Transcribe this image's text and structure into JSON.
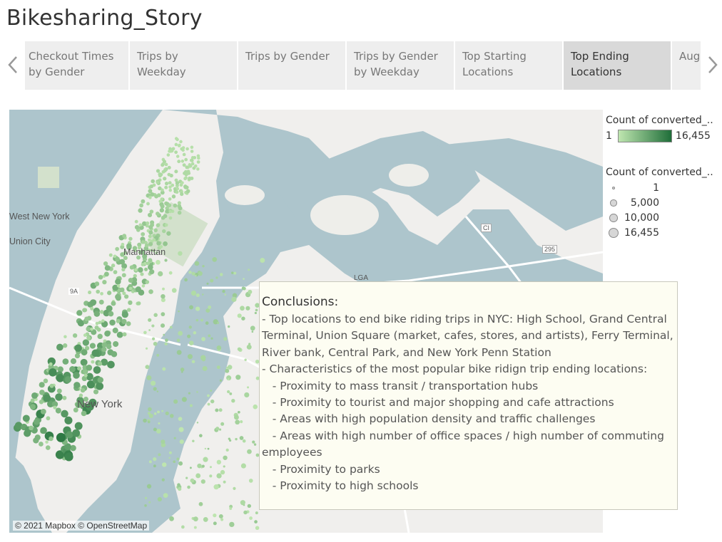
{
  "story_title": "Bikesharing_Story",
  "tabs": [
    {
      "label": "Checkout Times by Gender"
    },
    {
      "label": "Trips by Weekday"
    },
    {
      "label": "Trips by Gender"
    },
    {
      "label": "Trips by Gender by Weekday"
    },
    {
      "label": "Top Starting Locations"
    },
    {
      "label": "Top Ending Locations"
    },
    {
      "label": "August Hours"
    }
  ],
  "active_tab": 5,
  "map": {
    "attribution": "© 2021 Mapbox © OpenStreetMap",
    "labels": [
      "West New York",
      "Union City",
      "Manhattan",
      "New York",
      "LGA",
      "9A",
      "CI",
      "295"
    ]
  },
  "annotation": {
    "heading": "Conclusions:",
    "lines": [
      "- Top locations to end bike riding trips in NYC: High School, Grand Central Terminal, Union Square (market, cafes, stores, and artists), Ferry Terminal, River bank, Central Park, and New York Penn Station",
      "- Characteristics of the most popular bike ridign trip ending locations:",
      "   - Proximity to mass transit / transportation hubs",
      "   - Proximity to tourist and major shopping and cafe attractions",
      "   - Areas with high population density and traffic challenges",
      "   - Areas with high number of office spaces / high number of commuting employees",
      "   - Proximity to parks",
      "   - Proximity to high schools"
    ]
  },
  "legend_color": {
    "title": "Count of converted_..",
    "min": "1",
    "max": "16,455",
    "color_low": "#bfe6b0",
    "color_high": "#1f6e39"
  },
  "legend_size": {
    "title": "Count of converted_..",
    "items": [
      {
        "label": "1",
        "value": 1
      },
      {
        "label": "5,000",
        "value": 5000
      },
      {
        "label": "10,000",
        "value": 10000
      },
      {
        "label": "16,455",
        "value": 16455
      }
    ]
  },
  "icons": {
    "prev": "chevron-left-icon",
    "next": "chevron-right-icon"
  }
}
